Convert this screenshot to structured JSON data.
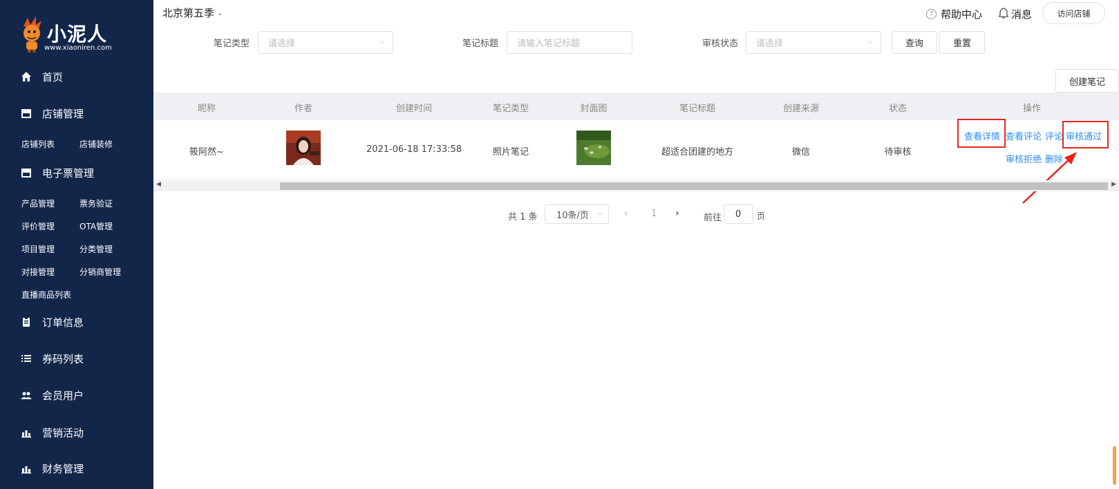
{
  "sidebar": {
    "logo_title": "小泥人",
    "logo_url": "www.xiaoniren.com",
    "home": "首页",
    "store_mgmt": "店铺管理",
    "store_list": "店铺列表",
    "store_decor": "店铺装修",
    "eticket_mgmt": "电子票管理",
    "product_mgmt": "产品管理",
    "ticket_verify": "票务验证",
    "review_mgmt": "评价管理",
    "ota_mgmt": "OTA管理",
    "project_mgmt": "项目管理",
    "category_mgmt": "分类管理",
    "docking_mgmt": "对接管理",
    "distributor_mgmt": "分销商管理",
    "live_products": "直播商品列表",
    "order_info": "订单信息",
    "coupon_list": "券码列表",
    "members": "会员用户",
    "marketing": "营销活动",
    "finance": "财务管理"
  },
  "topbar": {
    "store_name": "北京第五季",
    "help": "帮助中心",
    "messages": "消息",
    "visit_store": "访问店铺"
  },
  "filters": {
    "note_type_label": "笔记类型",
    "note_type_placeholder": "请选择",
    "note_title_label": "笔记标题",
    "note_title_placeholder": "请输入笔记标题",
    "review_status_label": "审核状态",
    "review_status_placeholder": "请选择",
    "query": "查询",
    "reset": "重置",
    "create_note": "创建笔记"
  },
  "table": {
    "headers": {
      "nickname": "昵称",
      "author": "作者",
      "created_at": "创建时间",
      "note_type": "笔记类型",
      "cover": "封面图",
      "note_title": "笔记标题",
      "source": "创建来源",
      "status": "状态",
      "actions": "操作"
    },
    "rows": [
      {
        "nickname": "筱阿然~",
        "created_at": "2021-06-18 17:33:58",
        "note_type": "照片笔记",
        "note_title": "超适合团建的地方",
        "source": "微信",
        "status": "待审核",
        "actions": {
          "view_detail": "查看详情",
          "view_comments": "查看评论",
          "comment": "评论",
          "approve": "审核通过",
          "reject": "审核拒绝",
          "delete": "删除"
        }
      }
    ]
  },
  "pagination": {
    "total": "共 1 条",
    "page_size": "10条/页",
    "current_page": "1",
    "goto_label": "前往",
    "goto_value": "0",
    "page_unit": "页"
  },
  "colors": {
    "sidebar_bg": "#12264a",
    "link": "#2d8cf0",
    "highlight": "#e8231c"
  }
}
